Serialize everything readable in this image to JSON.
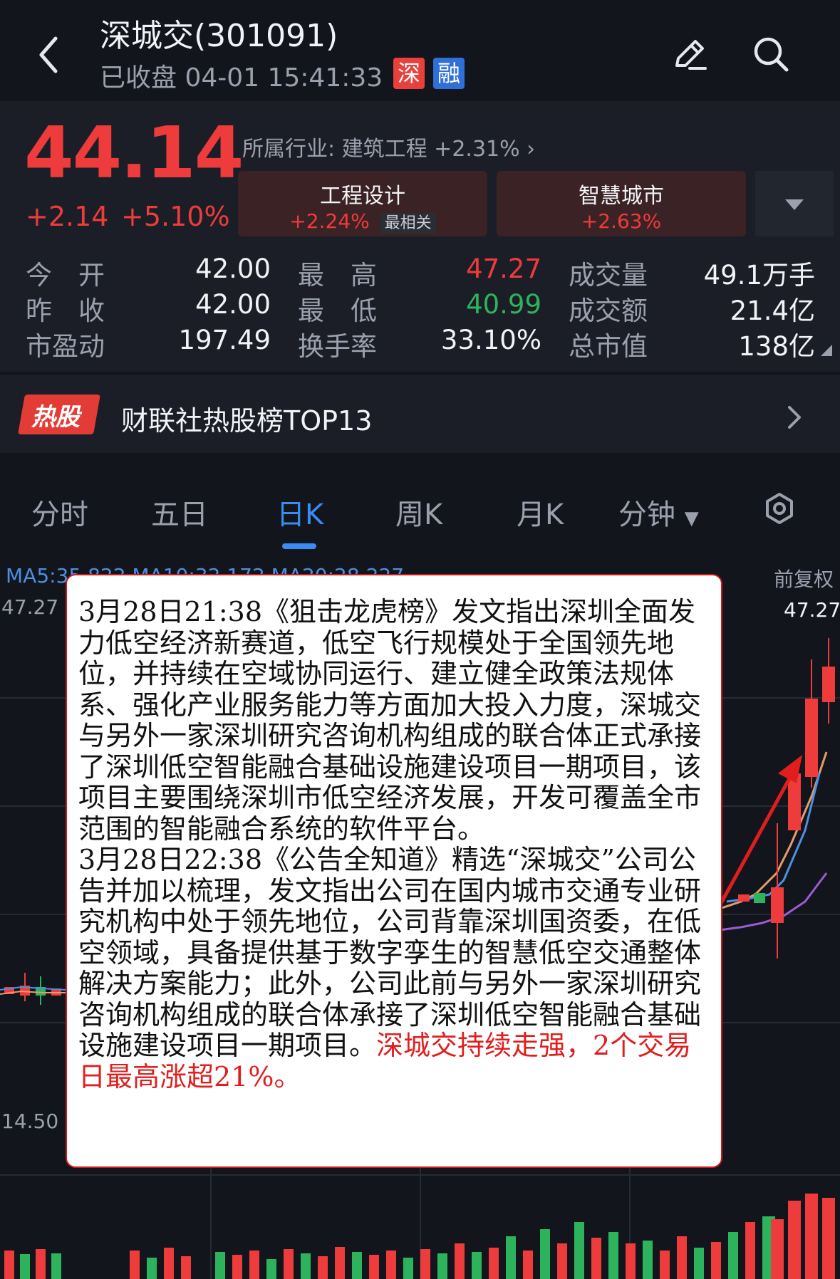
{
  "header": {
    "title": "深城交(301091)",
    "status": "已收盘 04-01 15:41:33",
    "tag_exchange": "深",
    "tag_margin": "融"
  },
  "quote": {
    "price": "44.14",
    "change": "+2.14",
    "change_pct": "+5.10%",
    "industry": "所属行业: 建筑工程 +2.31%",
    "concepts": [
      {
        "name": "工程设计",
        "change": "+2.24%",
        "badge": "最相关"
      },
      {
        "name": "智慧城市",
        "change": "+2.63%"
      }
    ],
    "stats": [
      {
        "label": "今　开",
        "value": "42.00"
      },
      {
        "label": "昨　收",
        "value": "42.00"
      },
      {
        "label": "市盈动",
        "value": "197.49"
      },
      {
        "label": "最　高",
        "value": "47.27"
      },
      {
        "label": "最　低",
        "value": "40.99"
      },
      {
        "label": "换手率",
        "value": "33.10%"
      },
      {
        "label": "成交量",
        "value": "49.1万手"
      },
      {
        "label": "成交额",
        "value": "21.4亿"
      },
      {
        "label": "总市值",
        "value": "138亿"
      }
    ]
  },
  "hot": {
    "badge": "热股",
    "text": "财联社热股榜TOP13"
  },
  "tabs": [
    "分时",
    "五日",
    "日K",
    "周K",
    "月K",
    "分钟"
  ],
  "chart": {
    "ma_legend": "MA5:35.822 MA10:32.172 MA20:28.227",
    "adjust": "前复权",
    "y_max": "47.27",
    "y_min": "14.50",
    "high_label": "47.27"
  },
  "colors": {
    "up": "#ee3b3b",
    "down": "#2db35c",
    "accent": "#3b8bf5",
    "background": "#12151c",
    "panel": "#1b1e26"
  },
  "popup": {
    "p1": "3月28日21:38《狙击龙虎榜》发文指出深圳全面发力低空经济新赛道，低空飞行规模处于全国领先地位，并持续在空域协同运行、建立健全政策法规体系、强化产业服务能力等方面加大投入力度，深城交与另外一家深圳研究咨询机构组成的联合体正式承接了深圳低空智能融合基础设施建设项目一期项目，该项目主要围绕深圳市低空经济发展，开发可覆盖全市范围的智能融合系统的软件平台。",
    "p2": "3月28日22:38《公告全知道》精选“深城交”公司公告并加以梳理，发文指出公司在国内城市交通专业研究机构中处于领先地位，公司背靠深圳国资委，在低空领域，具备提供基于数字孪生的智慧低空交通整体解决方案能力；此外，公司此前与另外一家深圳研究咨询机构组成的联合体承接了深圳低空智能融合基础设施建设项目一期项目。",
    "highlight": "深城交持续走强，2个交易日最高涨超21%。"
  }
}
